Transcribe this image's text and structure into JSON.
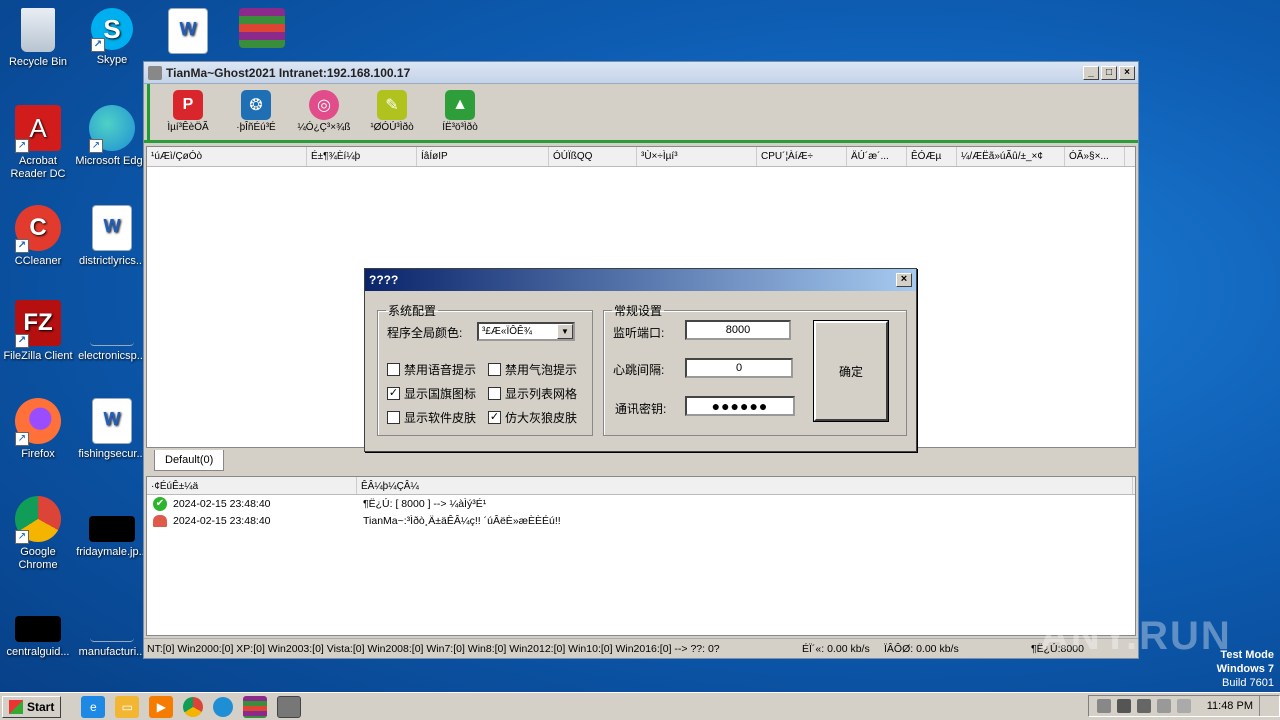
{
  "desktop": {
    "icons": [
      {
        "label": "Recycle Bin",
        "icon": "recycle-bin-icon",
        "color": "#cfd8e3"
      },
      {
        "label": "Skype",
        "icon": "skype-icon",
        "color": "#00aff0"
      },
      {
        "label": "",
        "icon": "word-doc-icon",
        "color": "#ffffff"
      },
      {
        "label": "",
        "icon": "winrar-icon",
        "color": "#8b2a8b"
      },
      {
        "label": "Acrobat Reader DC",
        "icon": "acrobat-icon",
        "color": "#d21c1c"
      },
      {
        "label": "Microsoft Edge",
        "icon": "edge-icon",
        "color": "#1e8fd5"
      },
      {
        "label": "CCleaner",
        "icon": "ccleaner-icon",
        "color": "#e23b2e"
      },
      {
        "label": "districtlyrics...",
        "icon": "word-doc-icon",
        "color": "#ffffff"
      },
      {
        "label": "FileZilla Client",
        "icon": "filezilla-icon",
        "color": "#b50f0f"
      },
      {
        "label": "electronicsp...",
        "icon": "blank-file-icon",
        "color": "#1565c0"
      },
      {
        "label": "Firefox",
        "icon": "firefox-icon",
        "color": "#ff7139"
      },
      {
        "label": "fishingsecur...",
        "icon": "word-doc-icon",
        "color": "#ffffff"
      },
      {
        "label": "Google Chrome",
        "icon": "chrome-icon",
        "color": "#4caf50"
      },
      {
        "label": "fridaymale.jp...",
        "icon": "image-file-icon",
        "color": "#000000"
      },
      {
        "label": "centralguid...",
        "icon": "image-file-icon",
        "color": "#000000"
      },
      {
        "label": "manufacturi...",
        "icon": "blank-file-icon",
        "color": "#1565c0"
      }
    ]
  },
  "window": {
    "title": "TianMa~Ghost2021 Intranet:192.168.100.17",
    "controls": {
      "minimize": "_",
      "maximize": "□",
      "close": "×"
    },
    "toolbar": [
      {
        "label": "Ìµí³ÊèÖÃ",
        "icon": "pinterest-icon",
        "color": "#d9262c"
      },
      {
        "label": "·þÎñÉú³É",
        "icon": "tools-icon",
        "color": "#1e6fb4"
      },
      {
        "label": "¼Ó¿Ç³×¾ß",
        "icon": "dribbble-icon",
        "color": "#e04d8a"
      },
      {
        "label": "¹ØÓÚ³Ìðò",
        "icon": "pencil-icon",
        "color": "#b0c21e"
      },
      {
        "label": "ÍË³ö³Ìðò",
        "icon": "tree-icon",
        "color": "#2e9e3a"
      }
    ],
    "columns": [
      "¹úÆì/ÇøÓò",
      "É±¶¾Èí¼þ",
      "ÍâÍøIP",
      "ÓÚÏßQQ",
      "³Ù×÷Ìµí³",
      "CPU´¦ÀíÆ÷",
      "ÄÚ´æ´...",
      "ÊÓÆµ",
      "¼/ÆËã»úÃû/±_×¢",
      "ÓÃ»§×..."
    ],
    "tab": "Default(0)",
    "log_columns": [
      "·¢ÉúÊ±¼ä",
      "ÊÂ¼þ¼ÇÂ¼"
    ],
    "log_rows": [
      {
        "time": "2024-02-15 23:48:40",
        "text": "¶Ë¿Ú: [ 8000 ]  --> ¼àÌý³É¹",
        "status": "ok"
      },
      {
        "time": "2024-02-15 23:48:40",
        "text": "TianMa~:³Ìðò¸Ä±äÊÂ¼ç!! ´úÂëÈ»æÈÈÉú!!",
        "status": "warn"
      }
    ],
    "status": {
      "os_counts": "NT:[0] Win2000:[0] XP:[0] Win2003:[0] Vista:[0] Win2008:[0] Win7:[0] Win8:[0] Win2012:[0] Win10:[0] Win2016:[0] --> ??: 0?",
      "send": "ÉÏ´«: 0.00 kb/s",
      "recv": "ÏÂÔØ: 0.00 kb/s",
      "port": "¶Ë¿Ú:8000"
    }
  },
  "dialog": {
    "title": "????",
    "system_group": {
      "legend": "系统配置",
      "color_label": "程序全局颜色:",
      "color_value": "³£Æ«ÏÔÊ¾",
      "checkboxes": [
        {
          "label": "禁用语音提示",
          "checked": false
        },
        {
          "label": "禁用气泡提示",
          "checked": false
        },
        {
          "label": "显示国旗图标",
          "checked": true
        },
        {
          "label": "显示列表网格",
          "checked": false
        },
        {
          "label": "显示软件皮肤",
          "checked": false
        },
        {
          "label": "仿大灰狼皮肤",
          "checked": true
        }
      ]
    },
    "general_group": {
      "legend": "常规设置",
      "port_label": "监听端口:",
      "port_value": "8000",
      "heartbeat_label": "心跳间隔:",
      "heartbeat_value": "0",
      "key_label": "通讯密钥:",
      "key_value": "●●●●●●"
    },
    "ok_button": "确定"
  },
  "overlay": {
    "watermark": "ANY.RUN",
    "test_mode": "Test Mode",
    "os_name": "Windows 7",
    "build": "Build 7601"
  },
  "taskbar": {
    "start": "Start",
    "time": "11:48 PM",
    "apps": [
      {
        "icon": "ie-icon",
        "color": "#1e88e5"
      },
      {
        "icon": "explorer-icon",
        "color": "#f2b632"
      },
      {
        "icon": "media-player-icon",
        "color": "#f57c00"
      },
      {
        "icon": "chrome-icon",
        "color": "#4caf50"
      },
      {
        "icon": "edge-icon",
        "color": "#1e8fd5"
      },
      {
        "icon": "winrar-icon",
        "color": "#8b2a8b"
      },
      {
        "icon": "ghost-app-icon",
        "color": "#777777"
      }
    ]
  }
}
